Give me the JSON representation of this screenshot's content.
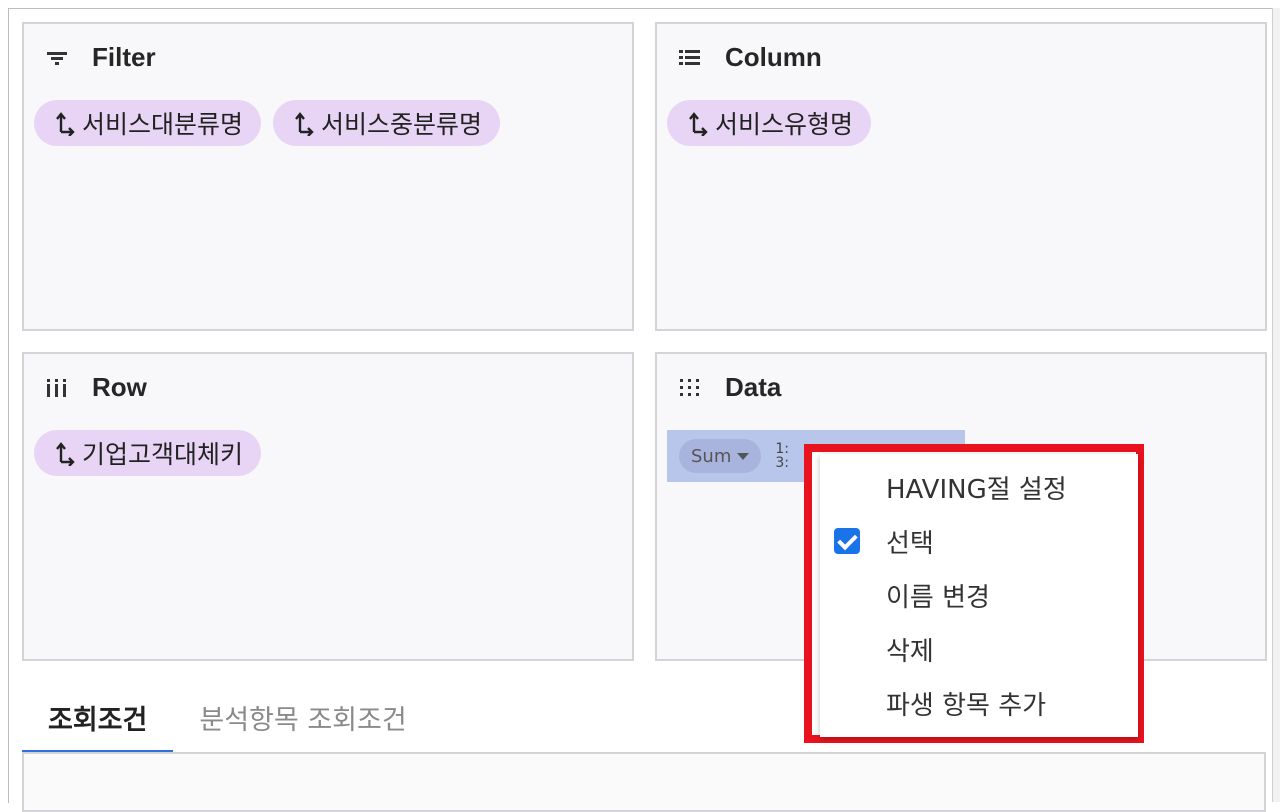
{
  "panels": {
    "filter": {
      "title": "Filter",
      "chips": [
        "서비스대분류명",
        "서비스중분류명"
      ]
    },
    "column": {
      "title": "Column",
      "chips": [
        "서비스유형명"
      ]
    },
    "row": {
      "title": "Row",
      "chips": [
        "기업고객대체키"
      ]
    },
    "data": {
      "title": "Data",
      "field": {
        "aggregation": "Sum",
        "label_line1": "1:",
        "label_line2": "3:"
      }
    }
  },
  "context_menu": {
    "items": [
      {
        "label": "HAVING절 설정",
        "checked": false
      },
      {
        "label": "선택",
        "checked": true
      },
      {
        "label": "이름 변경",
        "checked": false
      },
      {
        "label": "삭제",
        "checked": false
      },
      {
        "label": "파생 항목 추가",
        "checked": false
      }
    ],
    "highlight_color": "#e8131e"
  },
  "tabs": [
    {
      "label": "조회조건",
      "active": true
    },
    {
      "label": "분석항목 조회조건",
      "active": false
    }
  ],
  "colors": {
    "chip": "#e8d5f5",
    "data_field": "#b9c6ec",
    "tab_accent": "#2f6fde",
    "checkbox": "#1a73e8"
  }
}
